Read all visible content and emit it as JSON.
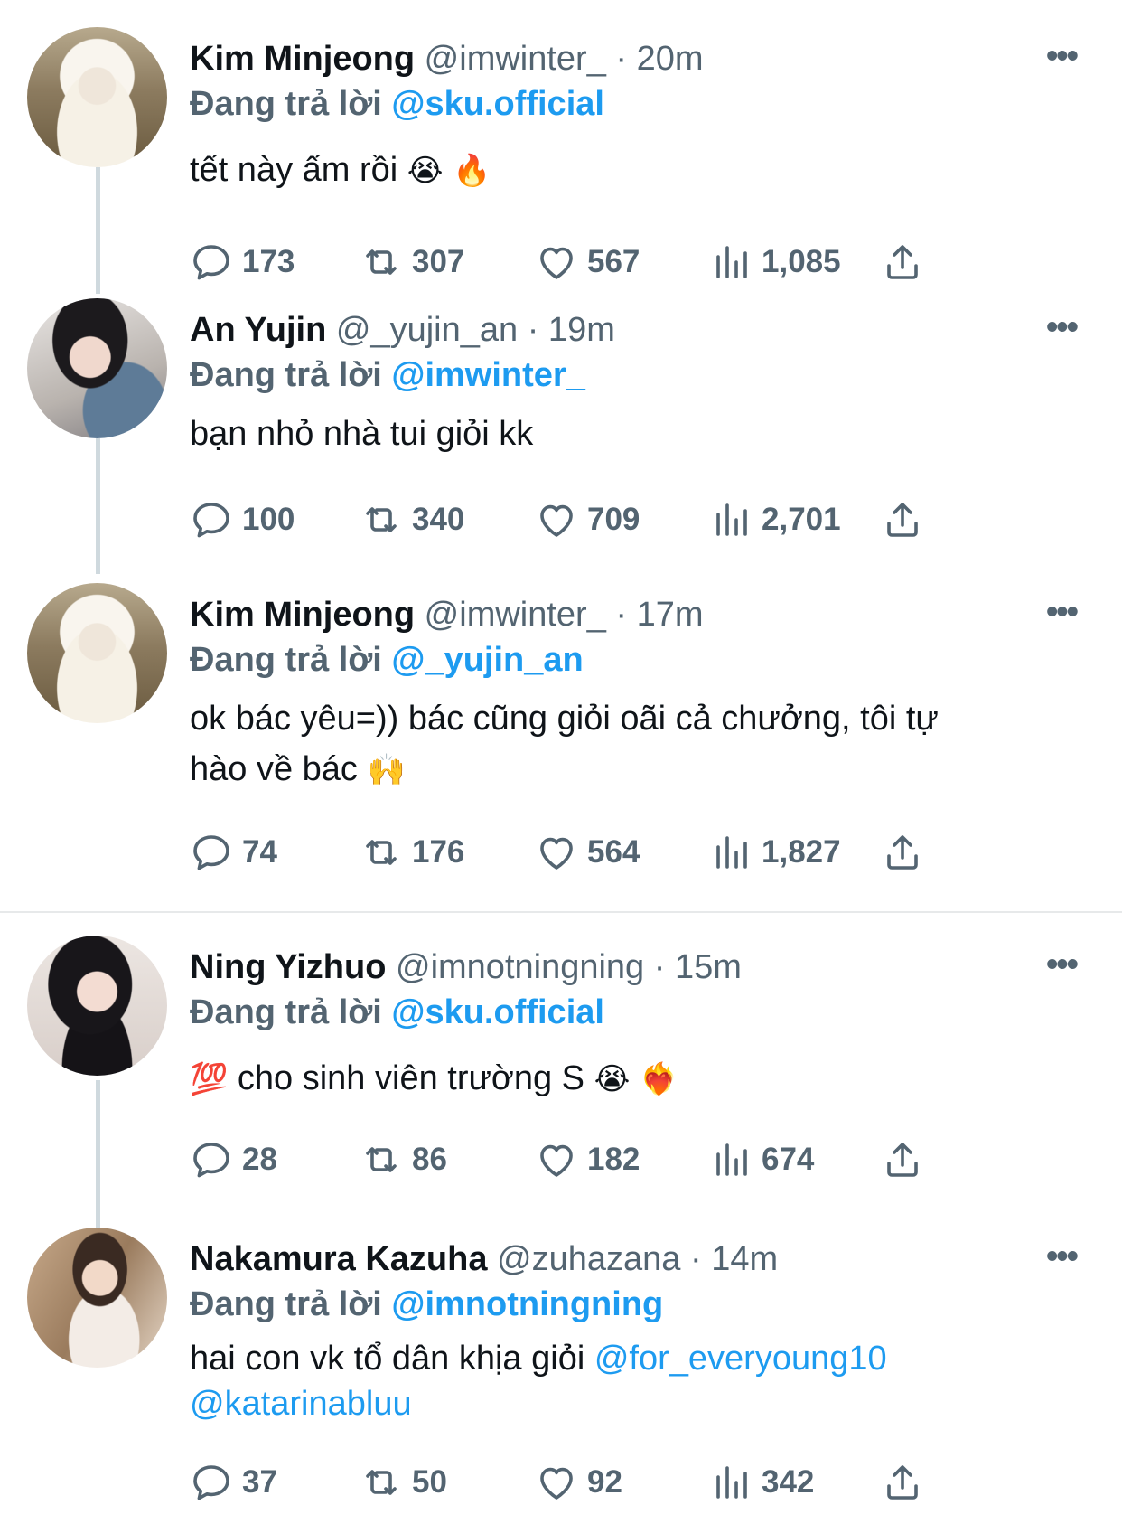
{
  "reply_prefix": "Đang trả lời",
  "tweets": [
    {
      "name": "Kim Minjeong",
      "handle": "@imwinter_",
      "time": "· 20m",
      "reply_to": "@sku.official",
      "text": "tết này ấm rồi",
      "emojis": "😭 🔥",
      "replies": "173",
      "retweets": "307",
      "likes": "567",
      "views": "1,085"
    },
    {
      "name": "An Yujin",
      "handle": "@_yujin_an",
      "time": "· 19m",
      "reply_to": "@imwinter_",
      "text": "bạn nhỏ nhà tui giỏi kk",
      "replies": "100",
      "retweets": "340",
      "likes": "709",
      "views": "2,701"
    },
    {
      "name": "Kim Minjeong",
      "handle": "@imwinter_",
      "time": "· 17m",
      "reply_to": "@_yujin_an",
      "text_line1": "ok bác yêu=)) bác cũng giỏi oãi cả chưởng, tôi tự",
      "text_line2": "hào về bác",
      "emojis": "🙌",
      "replies": "74",
      "retweets": "176",
      "likes": "564",
      "views": "1,827"
    },
    {
      "name": "Ning Yizhuo",
      "handle": "@imnotningning",
      "time": "· 15m",
      "reply_to": "@sku.official",
      "emoji_lead": "💯",
      "text": "cho sinh viên trường S",
      "emojis": "😭 ❤️‍🔥",
      "replies": "28",
      "retweets": "86",
      "likes": "182",
      "views": "674"
    },
    {
      "name": "Nakamura Kazuha",
      "handle": "@zuhazana",
      "time": "· 14m",
      "reply_to": "@imnotningning",
      "text": "hai con vk tổ dân khịa giỏi",
      "mention1": "@for_everyoung10",
      "mention2": "@katarinabluu",
      "replies": "37",
      "retweets": "50",
      "likes": "92",
      "views": "342"
    }
  ],
  "icons": {
    "reply": "reply-bubble-icon",
    "retweet": "retweet-icon",
    "like": "heart-icon",
    "views": "views-chart-icon",
    "share": "share-icon",
    "more": "more-dots-icon"
  },
  "colors": {
    "accent": "#1d9bf0",
    "secondary_text": "#536471",
    "primary_text": "#0f1419",
    "thread_line": "#cfd9de"
  }
}
